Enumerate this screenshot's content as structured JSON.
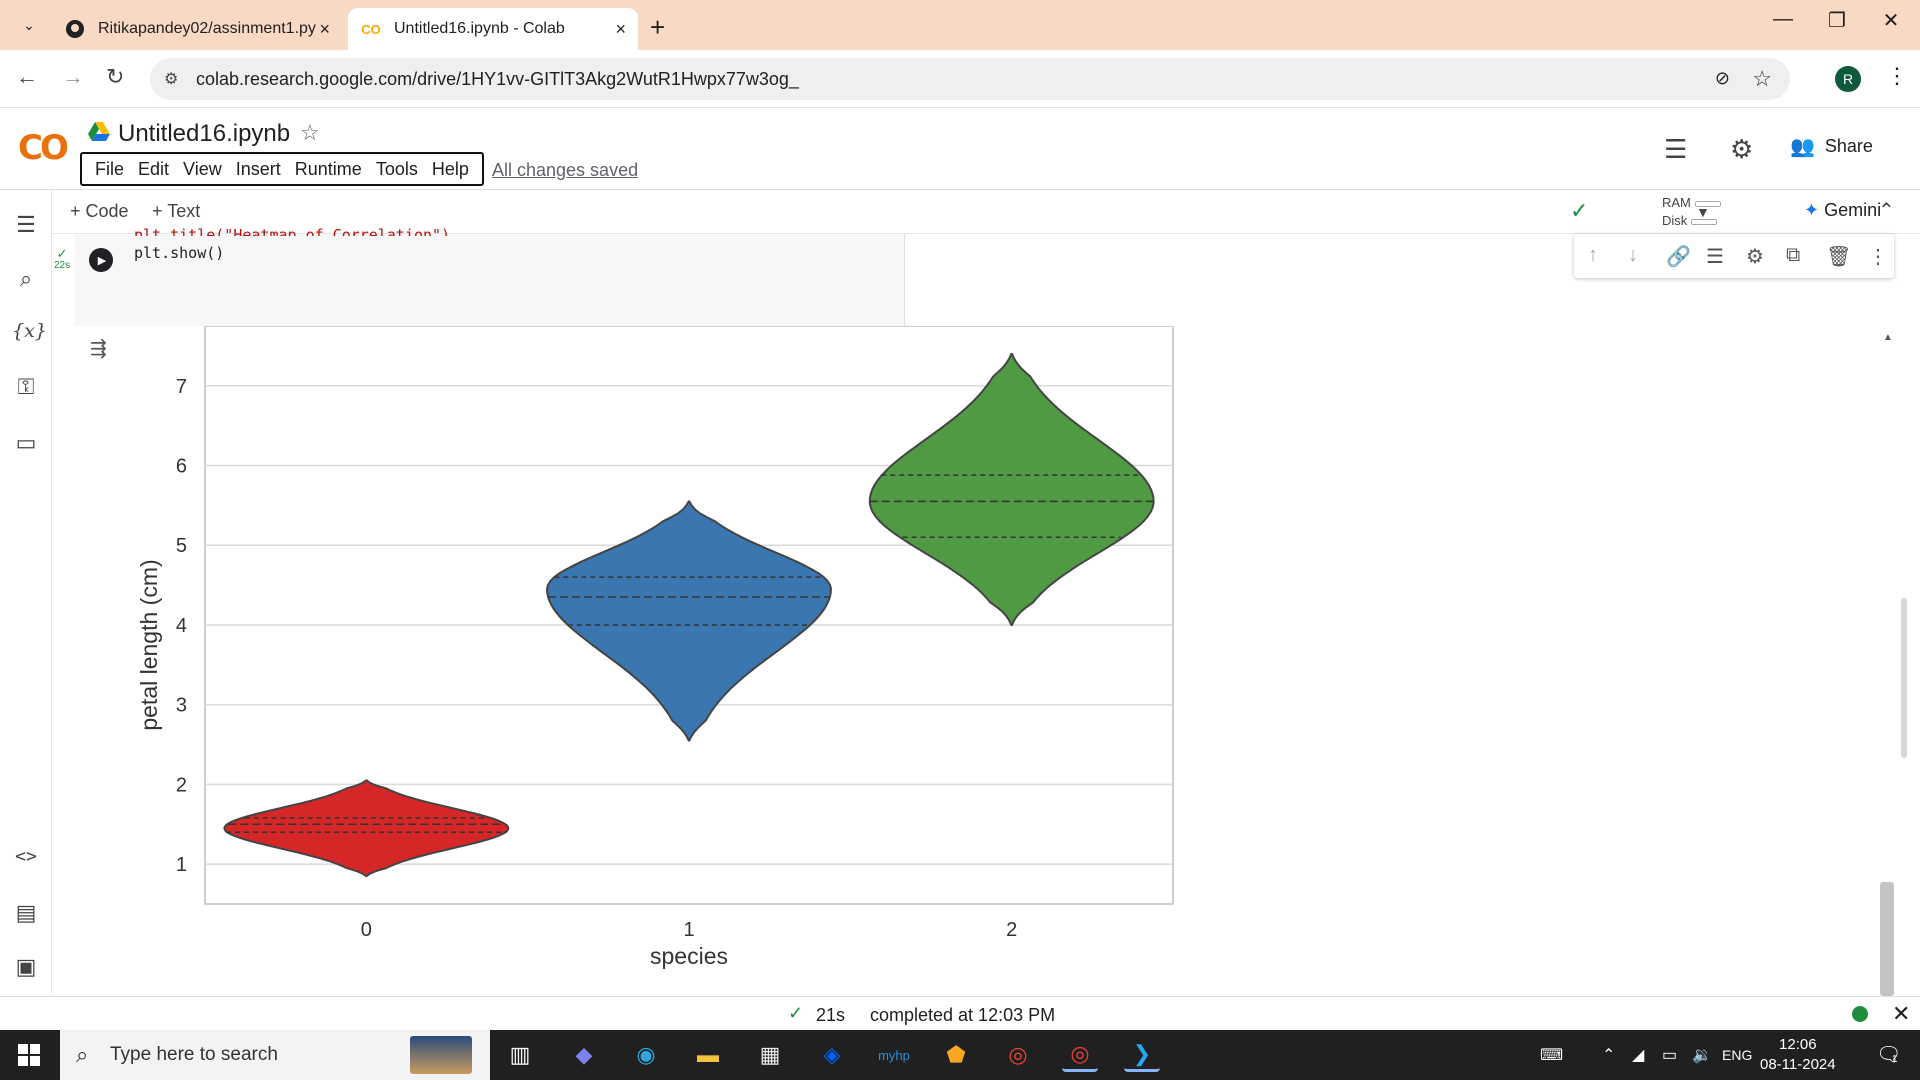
{
  "browser": {
    "tabs": [
      {
        "title": "Ritikapandey02/assinment1.py",
        "icon": "github-icon",
        "active": false
      },
      {
        "title": "Untitled16.ipynb - Colab",
        "icon": "colab-icon",
        "active": true
      }
    ],
    "url": "colab.research.google.com/drive/1HY1vv-GITlT3Akg2WutR1Hwpx77w3og_",
    "profile_initial": "R"
  },
  "colab": {
    "logo": "CO",
    "notebook_title": "Untitled16.ipynb",
    "menu": [
      "File",
      "Edit",
      "View",
      "Insert",
      "Runtime",
      "Tools",
      "Help"
    ],
    "save_status": "All changes saved",
    "share_label": "Share",
    "toolbar": {
      "add_code": "+ Code",
      "add_text": "+ Text",
      "ram_label": "RAM",
      "disk_label": "Disk",
      "gemini_label": "Gemini"
    }
  },
  "cell": {
    "exec_time": "22s",
    "clipped_line": "plt.title(\"Heatmap of Correlation\")",
    "code_line": "plt.show()"
  },
  "chart_data": {
    "type": "violin",
    "title": "",
    "xlabel": "species",
    "ylabel": "petal length (cm)",
    "categories": [
      "0",
      "1",
      "2"
    ],
    "yticks": [
      1,
      2,
      3,
      4,
      5,
      6,
      7
    ],
    "ylim": [
      0.5,
      7.75
    ],
    "grid": true,
    "colors": [
      "#d62728",
      "#3a76af",
      "#4f9a43"
    ],
    "series": [
      {
        "category": "0",
        "min": 0.85,
        "max": 2.05,
        "q1": 1.4,
        "median": 1.5,
        "q3": 1.58,
        "peak": 1.45
      },
      {
        "category": "1",
        "min": 2.55,
        "max": 5.55,
        "q1": 4.0,
        "median": 4.35,
        "q3": 4.6,
        "peak": 4.45
      },
      {
        "category": "2",
        "min": 4.0,
        "max": 7.4,
        "q1": 5.1,
        "median": 5.55,
        "q3": 5.88,
        "peak": 5.55
      }
    ]
  },
  "statusbar": {
    "duration": "21s",
    "completed": "completed at 12:03 PM"
  },
  "taskbar": {
    "search_placeholder": "Type here to search",
    "language": "ENG",
    "time": "12:06",
    "date": "08-11-2024",
    "notification_count": "1"
  }
}
